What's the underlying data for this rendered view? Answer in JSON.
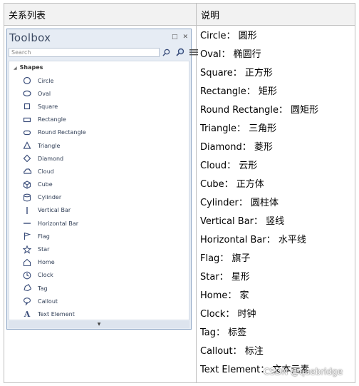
{
  "table": {
    "col1_header": "关系列表",
    "col2_header": "说明"
  },
  "toolbox": {
    "title": "Toolbox",
    "search_placeholder": "Search",
    "group_label": "Shapes",
    "items": [
      {
        "label": "Circle",
        "icon": "circle-icon"
      },
      {
        "label": "Oval",
        "icon": "oval-icon"
      },
      {
        "label": "Square",
        "icon": "square-icon"
      },
      {
        "label": "Rectangle",
        "icon": "rectangle-icon"
      },
      {
        "label": "Round Rectangle",
        "icon": "round-rectangle-icon"
      },
      {
        "label": "Triangle",
        "icon": "triangle-icon"
      },
      {
        "label": "Diamond",
        "icon": "diamond-icon"
      },
      {
        "label": "Cloud",
        "icon": "cloud-icon"
      },
      {
        "label": "Cube",
        "icon": "cube-icon"
      },
      {
        "label": "Cylinder",
        "icon": "cylinder-icon"
      },
      {
        "label": "Vertical Bar",
        "icon": "vertical-bar-icon"
      },
      {
        "label": "Horizontal Bar",
        "icon": "horizontal-bar-icon"
      },
      {
        "label": "Flag",
        "icon": "flag-icon"
      },
      {
        "label": "Star",
        "icon": "star-icon"
      },
      {
        "label": "Home",
        "icon": "home-icon"
      },
      {
        "label": "Clock",
        "icon": "clock-icon"
      },
      {
        "label": "Tag",
        "icon": "tag-icon"
      },
      {
        "label": "Callout",
        "icon": "callout-icon"
      },
      {
        "label": "Text Element",
        "icon": "text-element-icon"
      }
    ]
  },
  "descriptions": [
    "Circle：  圆形",
    "Oval：   椭圆行",
    "Square：  正方形",
    "Rectangle：  矩形",
    "Round Rectangle：  圆矩形",
    "Triangle：  三角形",
    "Diamond：  菱形",
    "Cloud：  云形",
    "Cube：  正方体",
    "Cylinder：  圆柱体",
    "Vertical Bar：  竖线",
    "Horizontal Bar：  水平线",
    "Flag：  旗子",
    "Star：   星形",
    "Home：   家",
    "Clock：   时钟",
    "Tag：  标签",
    "Callout：  标注",
    "Text Element：  文本元素"
  ],
  "watermark": "CSDN @quebridge",
  "colors": {
    "icon": "#3a4d7a",
    "panel_border": "#8fa7c6"
  }
}
